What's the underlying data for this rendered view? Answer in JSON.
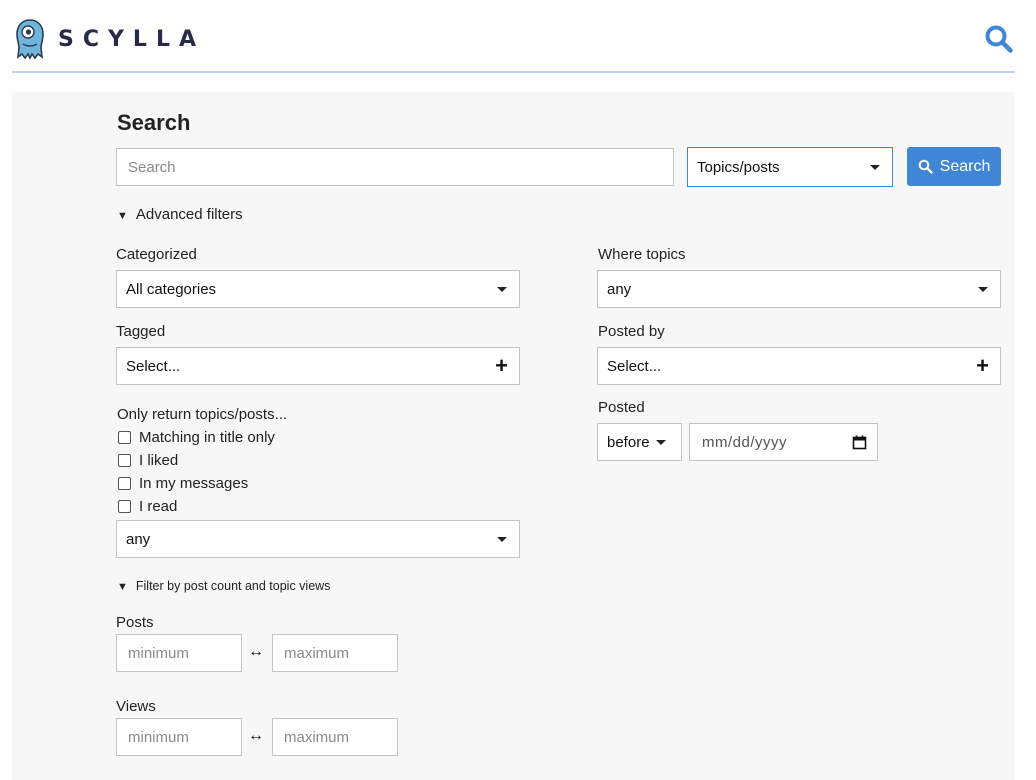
{
  "brand": {
    "name": "SCYLLA"
  },
  "header": {
    "search_icon": "search-icon"
  },
  "page": {
    "title": "Search"
  },
  "search": {
    "placeholder": "Search",
    "value": "",
    "type_selected": "Topics/posts",
    "button_label": "Search"
  },
  "advanced": {
    "toggle_label": "Advanced filters",
    "categorized": {
      "label": "Categorized",
      "selected": "All categories"
    },
    "where_topics": {
      "label": "Where topics",
      "selected": "any"
    },
    "tagged": {
      "label": "Tagged",
      "placeholder": "Select..."
    },
    "posted_by": {
      "label": "Posted by",
      "placeholder": "Select..."
    },
    "only_return": {
      "label": "Only return topics/posts...",
      "options": [
        {
          "label": "Matching in title only",
          "checked": false
        },
        {
          "label": "I liked",
          "checked": false
        },
        {
          "label": "In my messages",
          "checked": false
        },
        {
          "label": "I read",
          "checked": false
        }
      ],
      "status_selected": "any"
    },
    "posted": {
      "label": "Posted",
      "relation": "before",
      "date_placeholder": "mm/dd/yyyy"
    },
    "count_filter": {
      "toggle_label": "Filter by post count and topic views",
      "posts": {
        "label": "Posts",
        "min_placeholder": "minimum",
        "max_placeholder": "maximum"
      },
      "views": {
        "label": "Views",
        "min_placeholder": "minimum",
        "max_placeholder": "maximum"
      },
      "separator": "↔"
    }
  },
  "colors": {
    "accent": "#3f86d6",
    "brand_text": "#282a4a",
    "panel_bg": "#f7f7f7"
  }
}
